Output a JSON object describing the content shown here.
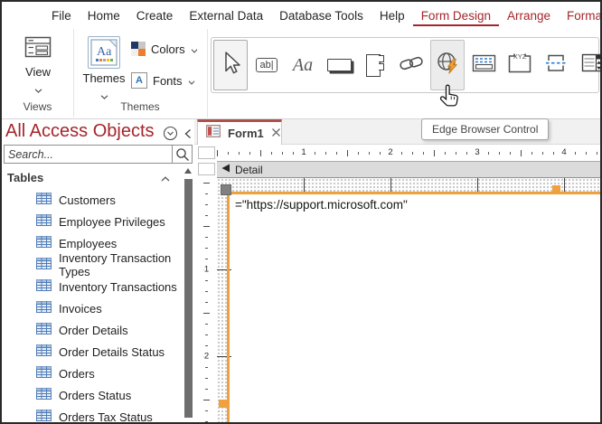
{
  "menu": {
    "items": [
      "File",
      "Home",
      "Create",
      "External Data",
      "Database Tools",
      "Help",
      "Form Design",
      "Arrange",
      "Format"
    ],
    "active": "Form Design"
  },
  "ribbon": {
    "views": {
      "button": "View",
      "group": "Views"
    },
    "themes": {
      "button": "Themes",
      "colors": "Colors",
      "fonts": "Fonts",
      "group": "Themes",
      "themes_glyph": "Aa",
      "fonts_glyph": "A"
    },
    "gallery": {
      "textbox_glyph": "ab|",
      "label_glyph": "Aa",
      "xyz_glyph": "XYZ",
      "icons": [
        "select",
        "text-box",
        "label",
        "button",
        "tab-control",
        "hyperlink",
        "edge-browser-control",
        "navigation-control",
        "xyz-group",
        "page-break",
        "combo-box"
      ]
    }
  },
  "tooltip": {
    "text": "Edge Browser Control"
  },
  "sidebar": {
    "title": "All Access Objects",
    "search_placeholder": "Search...",
    "section": "Tables",
    "items": [
      "Customers",
      "Employee Privileges",
      "Employees",
      "Inventory Transaction Types",
      "Inventory Transactions",
      "Invoices",
      "Order Details",
      "Order Details Status",
      "Orders",
      "Orders Status",
      "Orders Tax Status"
    ]
  },
  "document": {
    "tab": "Form1",
    "section": "Detail",
    "expression": "=\"https://support.microsoft.com\"",
    "hruler": [
      "1",
      "2",
      "3",
      "4"
    ],
    "vruler": [
      "1",
      "2"
    ]
  },
  "colors": {
    "accent_red": "#A4262C",
    "selection_orange": "#F0A03C"
  }
}
